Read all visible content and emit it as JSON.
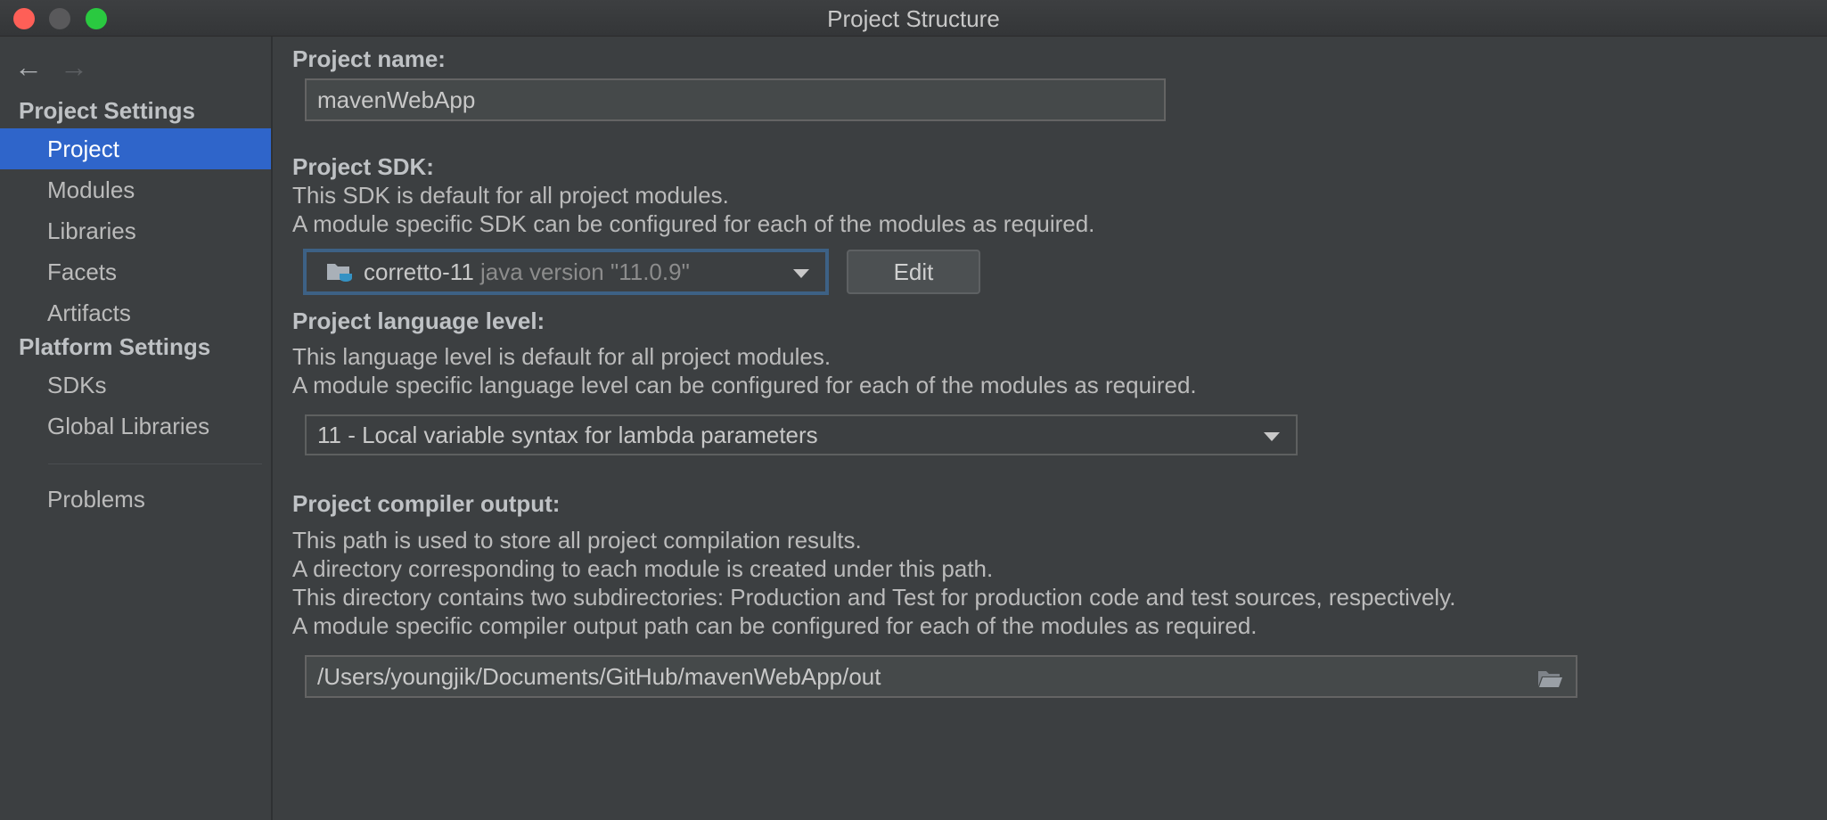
{
  "window": {
    "title": "Project Structure"
  },
  "sidebar": {
    "project_settings_title": "Project Settings",
    "project_items": [
      {
        "label": "Project",
        "selected": true
      },
      {
        "label": "Modules",
        "selected": false
      },
      {
        "label": "Libraries",
        "selected": false
      },
      {
        "label": "Facets",
        "selected": false
      },
      {
        "label": "Artifacts",
        "selected": false
      }
    ],
    "platform_settings_title": "Platform Settings",
    "platform_items": [
      {
        "label": "SDKs"
      },
      {
        "label": "Global Libraries"
      }
    ],
    "problems_label": "Problems"
  },
  "main": {
    "project_name": {
      "label": "Project name:",
      "value": "mavenWebApp"
    },
    "project_sdk": {
      "label": "Project SDK:",
      "desc_line1": "This SDK is default for all project modules.",
      "desc_line2": "A module specific SDK can be configured for each of the modules as required.",
      "selected_name": "corretto-11",
      "selected_version": "java version \"11.0.9\"",
      "edit_label": "Edit"
    },
    "language_level": {
      "label": "Project language level:",
      "desc_line1": "This language level is default for all project modules.",
      "desc_line2": "A module specific language level can be configured for each of the modules as required.",
      "selected": "11 - Local variable syntax for lambda parameters"
    },
    "compiler_output": {
      "label": "Project compiler output:",
      "desc_line1": "This path is used to store all project compilation results.",
      "desc_line2": "A directory corresponding to each module is created under this path.",
      "desc_line3": "This directory contains two subdirectories: Production and Test for production code and test sources, respectively.",
      "desc_line4": "A module specific compiler output path can be configured for each of the modules as required.",
      "path": "/Users/youngjik/Documents/GitHub/mavenWebApp/out"
    }
  },
  "colors": {
    "background": "#3c3f41",
    "selection": "#2f65ca",
    "focus_border": "#3d6185",
    "close": "#fe5f57",
    "maximize": "#2ac940"
  }
}
